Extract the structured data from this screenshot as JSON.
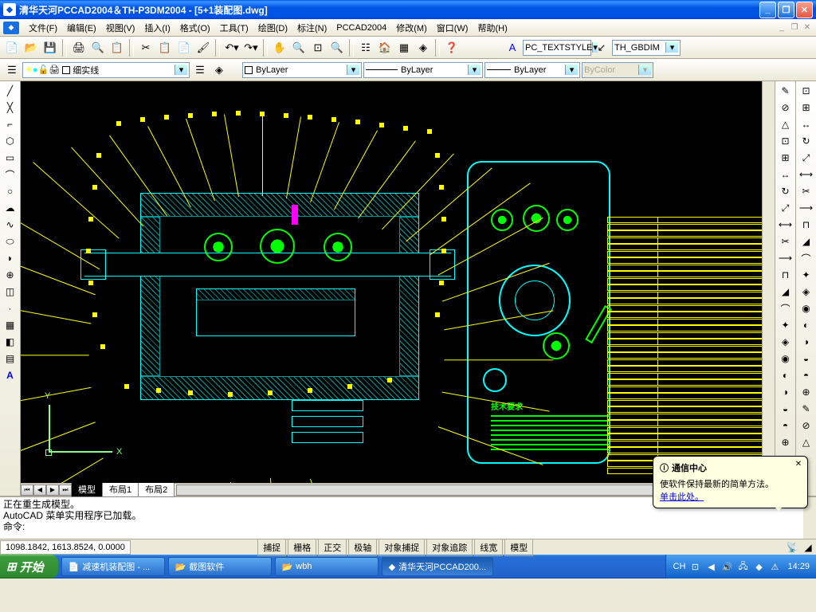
{
  "title": "清华天河PCCAD2004＆TH-P3DM2004 - [5+1装配图.dwg]",
  "menu": [
    "文件(F)",
    "编辑(E)",
    "视图(V)",
    "插入(I)",
    "格式(O)",
    "工具(T)",
    "绘图(D)",
    "标注(N)",
    "PCCAD2004",
    "修改(M)",
    "窗口(W)",
    "帮助(H)"
  ],
  "toolbar1_icons": [
    "new-icon",
    "open-icon",
    "save-icon",
    "plot-icon",
    "preview-icon",
    "publish-icon",
    "cut-icon",
    "copy-icon",
    "paste-icon",
    "match-icon",
    "undo-icon",
    "redo-icon",
    "pan-icon",
    "zoom-icon",
    "zoom-prev-icon",
    "props-icon",
    "dcenter-icon",
    "toolpal-icon",
    "help-icon"
  ],
  "textstyle": {
    "label": "PC_TEXTSTYLE"
  },
  "dimstyle": {
    "label": "TH_GBDIM"
  },
  "layer": {
    "current": "细实线"
  },
  "ltype": {
    "current": "ByLayer",
    "lt": "ByLayer",
    "lw": "ByLayer",
    "color": "ByColor"
  },
  "left_tools": [
    "line-icon",
    "xline-icon",
    "pline-icon",
    "polygon-icon",
    "rect-icon",
    "arc-icon",
    "circle-icon",
    "revcloud-icon",
    "spline-icon",
    "ellipse-icon",
    "earc-icon",
    "insert-icon",
    "block-icon",
    "point-icon",
    "hatch-icon",
    "region-icon",
    "table-icon",
    "mtext-icon"
  ],
  "right_tools_a": [
    "dist-icon",
    "area-icon",
    "mass-icon",
    "list-icon",
    "id-icon",
    "time-icon",
    "status-icon",
    "var-icon",
    "calc-icon",
    "dim1-icon",
    "dim2-icon",
    "dim3-icon",
    "dim4-icon",
    "dim5-icon",
    "dim6-icon",
    "dim7-icon",
    "dim8-icon",
    "dim9-icon",
    "dim10-icon",
    "dim11-icon",
    "dim12-icon",
    "dim13-icon"
  ],
  "right_tools_b": [
    "erase-icon",
    "copy2-icon",
    "mirror-icon",
    "offset-icon",
    "array-icon",
    "move-icon",
    "rotate-icon",
    "scale-icon",
    "stretch-icon",
    "trim-icon",
    "extend-icon",
    "break-icon",
    "chamfer-icon",
    "fillet-icon",
    "explode-icon",
    "e1-icon",
    "e2-icon",
    "e3-icon",
    "e4-icon",
    "e5-icon",
    "e6-icon",
    "e7-icon"
  ],
  "ucs": {
    "x": "X",
    "y": "Y"
  },
  "notes_title": "技术要求",
  "tabs": [
    "模型",
    "布局1",
    "布局2"
  ],
  "cmd": {
    "line1": "正在重生成模型。",
    "line2": "AutoCAD 菜单实用程序已加载。",
    "prompt": "命令:"
  },
  "status": {
    "coords": "1098.1842, 1613.8524, 0.0000",
    "modes": [
      "捕捉",
      "栅格",
      "正交",
      "极轴",
      "对象捕捉",
      "对象追踪",
      "线宽",
      "模型"
    ]
  },
  "notif": {
    "title": "通信中心",
    "body": "使软件保持最新的简单方法。",
    "link": "单击此处。"
  },
  "taskbar": {
    "start": "开始",
    "items": [
      "减速机装配图 - ...",
      "截图软件",
      "wbh",
      "清华天河PCCAD200..."
    ],
    "lang": "CH",
    "time": "14:29"
  }
}
